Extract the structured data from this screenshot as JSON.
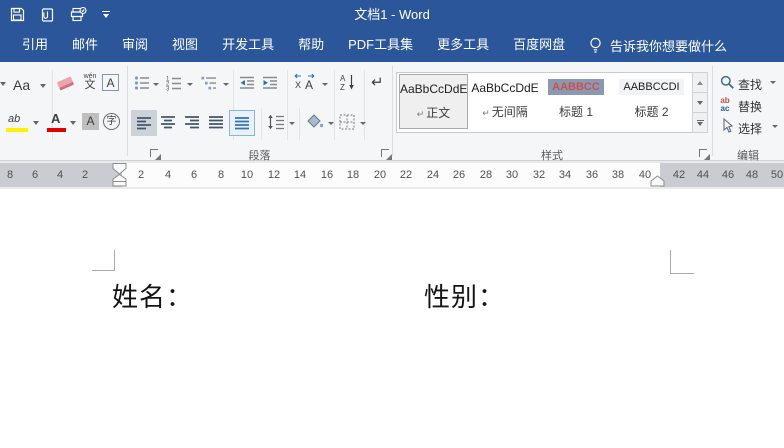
{
  "title_bar": {
    "title": "文档1 - Word"
  },
  "tabs": {
    "items": [
      "引用",
      "邮件",
      "审阅",
      "视图",
      "开发工具",
      "帮助",
      "PDF工具集",
      "更多工具",
      "百度网盘"
    ],
    "tell_me": "告诉我你想要做什么"
  },
  "ribbon": {
    "font_group": {
      "change_case": "Aa",
      "phonetic_top": "wén",
      "phonetic_bottom": "文",
      "character_border": "A",
      "highlight": "ab",
      "font_color": "A",
      "character_shading": "A",
      "enclose_characters": "字"
    },
    "paragraph_group": {
      "label": "段落",
      "asian_x": "X",
      "asian_a": "A",
      "sort_a": "A",
      "sort_z": "Z",
      "show_marks": "↵",
      "numbering_digits": [
        "1",
        "2",
        "3"
      ]
    },
    "styles_group": {
      "label": "样式",
      "styles": [
        {
          "preview": "AaBbCcDdE",
          "prefix": "↵",
          "name": "正文"
        },
        {
          "preview": "AaBbCcDdE",
          "prefix": "↵",
          "name": "无间隔"
        },
        {
          "preview": "AABBCC",
          "prefix": "",
          "name": "标题 1"
        },
        {
          "preview": "AABBCCDI",
          "prefix": "",
          "name": "标题 2"
        }
      ]
    },
    "editing_group": {
      "label": "编辑",
      "find": "查找",
      "replace": "替换",
      "select": "选择",
      "replace_icon_top": "ab",
      "replace_icon_bottom": "ac"
    }
  },
  "ruler": {
    "left_numbers": [
      "8",
      "6",
      "4",
      "2"
    ],
    "middle_numbers": [
      "2",
      "4",
      "6",
      "8",
      "10",
      "12",
      "14",
      "16",
      "18",
      "20",
      "22",
      "24",
      "26",
      "28",
      "30",
      "32",
      "34",
      "36",
      "38",
      "40"
    ],
    "right_numbers": [
      "42",
      "44",
      "46",
      "48",
      "50"
    ]
  },
  "document": {
    "name_label": "姓名：",
    "gender_label": "性别："
  },
  "colors": {
    "titlebar": "#2B579A",
    "ribbon_bg": "#F5F6F8",
    "heading1_preview_bg": "#8A99B2",
    "heading1_preview_fg": "#C9524E",
    "highlight_yellow": "#FFF000",
    "font_color_red": "#E00000"
  }
}
